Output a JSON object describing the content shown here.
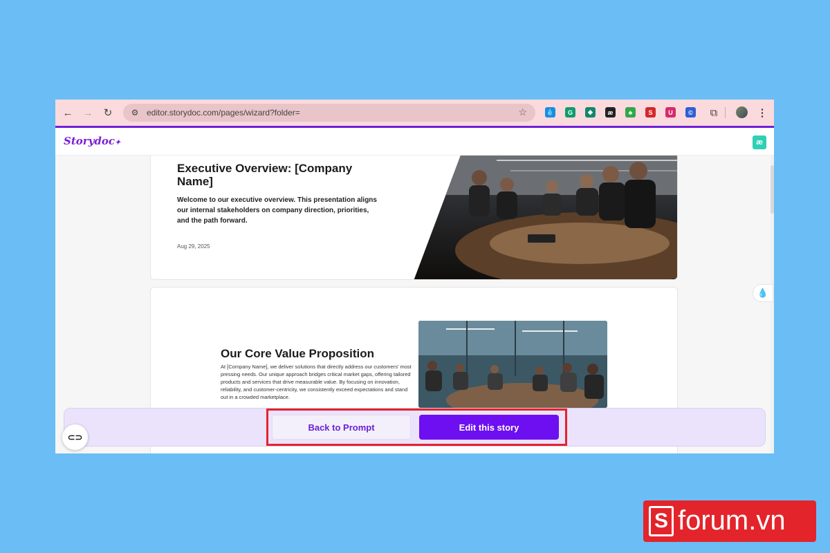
{
  "browser": {
    "url": "editor.storydoc.com/pages/wizard?folder=",
    "extensions": [
      {
        "icon": "drop-extension-icon",
        "color": "#1a8de0",
        "glyph": "💧"
      },
      {
        "icon": "grammarly-icon",
        "color": "#0f9c6c",
        "glyph": "G"
      },
      {
        "icon": "extension-green-icon",
        "color": "#12866b",
        "glyph": "◆"
      },
      {
        "icon": "ae-extension-icon",
        "color": "#222222",
        "glyph": "æ"
      },
      {
        "icon": "frog-extension-icon",
        "color": "#2fa84a",
        "glyph": "♣"
      },
      {
        "icon": "s-extension-icon",
        "color": "#d6272b",
        "glyph": "S"
      },
      {
        "icon": "shield-extension-icon",
        "color": "#d62b6b",
        "glyph": "U"
      },
      {
        "icon": "copyright-extension-icon",
        "color": "#2e5fd6",
        "glyph": "©"
      }
    ]
  },
  "app": {
    "logo": "Storydoc",
    "badge": "æ"
  },
  "card1": {
    "title": "Executive Overview: [Company Name]",
    "description": "Welcome to our executive overview. This presentation aligns our internal stakeholders on company direction, priorities, and the path forward.",
    "date": "Aug 29, 2025"
  },
  "card2": {
    "title": "Our Core Value Proposition",
    "description": "At [Company Name], we deliver solutions that directly address our customers' most pressing needs. Our unique approach bridges critical market gaps, offering tailored products and services that drive measurable value. By focusing on innovation, reliability, and customer-centricity, we consistently exceed expectations and stand out in a crowded marketplace."
  },
  "actions": {
    "back_label": "Back to Prompt",
    "edit_label": "Edit this story"
  },
  "watermark": {
    "text": "forum.vn",
    "letter": "S"
  }
}
